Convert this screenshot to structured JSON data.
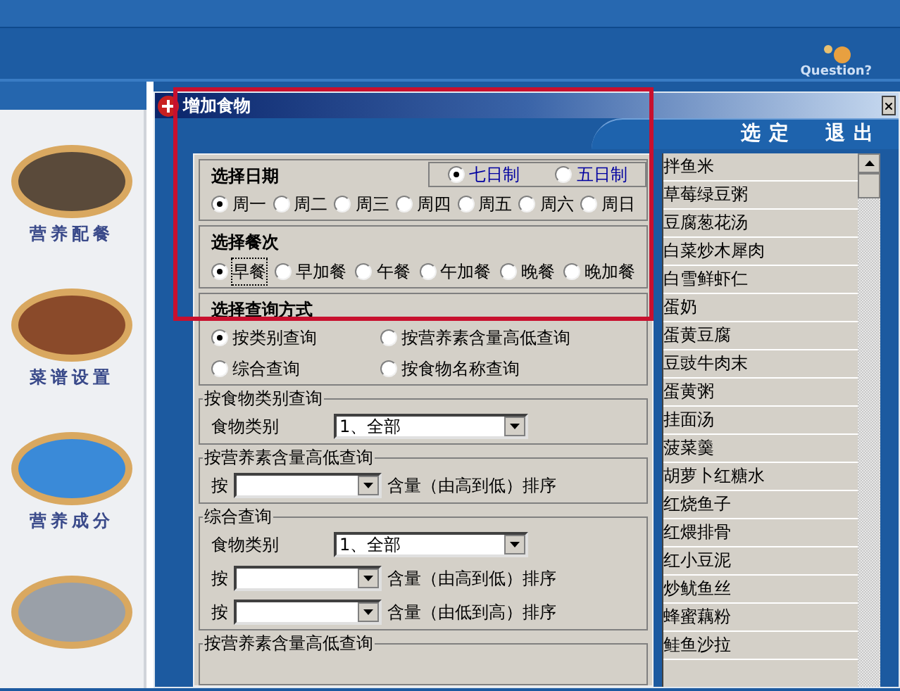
{
  "header": {
    "help_label": "Question?"
  },
  "sidebar": {
    "items": [
      {
        "label": "营养配餐",
        "kind": "dish"
      },
      {
        "label": "菜谱设置",
        "kind": "cake"
      },
      {
        "label": "营养成分",
        "kind": "chef"
      },
      {
        "kind": "partial"
      }
    ]
  },
  "dialog": {
    "title": "增加食物",
    "toolbar": [
      "选定",
      "退出"
    ],
    "date_section": {
      "title": "选择日期",
      "modes": [
        {
          "label": "七日制",
          "selected": true
        },
        {
          "label": "五日制",
          "selected": false
        }
      ],
      "days": [
        {
          "label": "周一",
          "selected": true
        },
        {
          "label": "周二",
          "selected": false
        },
        {
          "label": "周三",
          "selected": false
        },
        {
          "label": "周四",
          "selected": false
        },
        {
          "label": "周五",
          "selected": false
        },
        {
          "label": "周六",
          "selected": false
        },
        {
          "label": "周日",
          "selected": false
        }
      ]
    },
    "meal_section": {
      "title": "选择餐次",
      "options": [
        {
          "label": "早餐",
          "selected": true,
          "focused": true
        },
        {
          "label": "早加餐",
          "selected": false,
          "focused": false
        },
        {
          "label": "午餐",
          "selected": false,
          "focused": false
        },
        {
          "label": "午加餐",
          "selected": false,
          "focused": false
        },
        {
          "label": "晚餐",
          "selected": false,
          "focused": false
        },
        {
          "label": "晚加餐",
          "selected": false,
          "focused": false
        }
      ]
    },
    "query_section": {
      "title": "选择查询方式",
      "options": [
        {
          "label": "按类别查询",
          "selected": true
        },
        {
          "label": "按营养素含量高低查询",
          "selected": false
        },
        {
          "label": "综合查询",
          "selected": false
        },
        {
          "label": "按食物名称查询",
          "selected": false
        }
      ]
    },
    "groups": [
      {
        "title": "按食物类别查询",
        "rows": [
          {
            "kind": "select",
            "label": "食物类别",
            "value": "1、全部"
          }
        ]
      },
      {
        "title": "按营养素含量高低查询",
        "rows": [
          {
            "kind": "sort",
            "label": "按",
            "suffix": "含量（由高到低）排序"
          }
        ]
      },
      {
        "title": "综合查询",
        "rows": [
          {
            "kind": "select",
            "label": "食物类别",
            "value": "1、全部"
          },
          {
            "kind": "sort",
            "label": "按",
            "suffix": "含量（由高到低）排序"
          },
          {
            "kind": "sort",
            "label": "按",
            "suffix": "含量（由低到高）排序"
          }
        ]
      },
      {
        "title": "按营养素含量高低查询"
      }
    ],
    "food_list": [
      "拌鱼米",
      "草莓绿豆粥",
      "豆腐葱花汤",
      "白菜炒木犀肉",
      "白雪鲜虾仁",
      "蛋奶",
      "蛋黄豆腐",
      "豆豉牛肉末",
      "蛋黄粥",
      "挂面汤",
      "菠菜羹",
      "胡萝卜红糖水",
      "红烧鱼子",
      "红煨排骨",
      "红小豆泥",
      "炒鱿鱼丝",
      "蜂蜜藕粉",
      "鲑鱼沙拉"
    ]
  }
}
